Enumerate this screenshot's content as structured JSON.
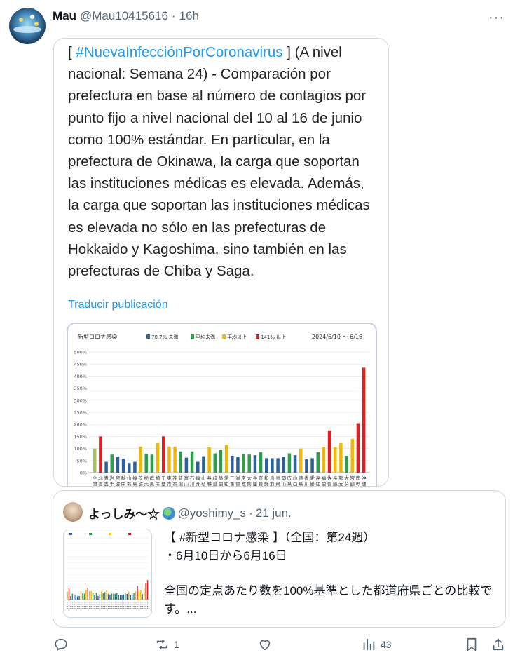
{
  "author": {
    "name": "Mau",
    "handle": "@Mau10415616",
    "separator": "·",
    "time": "16h"
  },
  "menu": {
    "more_label": "···"
  },
  "post": {
    "open_bracket": "[ ",
    "hashtag": "#NuevaInfecciónPorCoronavirus",
    "text_rest": " ] (A nivel nacional: Semana 24) - Comparación por prefectura en base al número de contagios por punto fijo a nivel nacional del 10 al 16 de junio como 100% estándar. En particular, en la prefectura de Okinawa, la carga que soportan las instituciones médicas es elevada. Además, la carga que soportan las instituciones médicas es elevada no sólo en las prefecturas de Hokkaido y Kagoshima, sino también en las prefecturas de Chiba y Saga.",
    "translate_label": "Traducir publicación"
  },
  "chart_data": {
    "type": "bar",
    "title": "新型コロナ感染",
    "date_range": "2024/6/10 ～ 6/16",
    "legend": [
      {
        "name": "70.7% 未満",
        "color": "#2e5f9e"
      },
      {
        "name": "平均未満",
        "color": "#2f9d4e"
      },
      {
        "name": "平均以上",
        "color": "#f2b705"
      },
      {
        "name": "141% 以上",
        "color": "#e02020"
      }
    ],
    "y_ticks": [
      "0%",
      "50%",
      "100%",
      "150%",
      "200%",
      "250%",
      "300%",
      "350%",
      "400%",
      "450%",
      "500%"
    ],
    "ylim": [
      0,
      500
    ],
    "categories": [
      "全国",
      "北海",
      "青森",
      "岩手",
      "宮城",
      "秋田",
      "山形",
      "福島",
      "茨城",
      "栃木",
      "群馬",
      "埼玉",
      "千葉",
      "東京",
      "神奈",
      "新潟",
      "富山",
      "石川",
      "福井",
      "山梨",
      "長野",
      "岐阜",
      "静岡",
      "愛知",
      "三重",
      "滋賀",
      "京都",
      "大阪",
      "兵庫",
      "奈良",
      "和歌",
      "鳥取",
      "島根",
      "岡山",
      "広島",
      "山口",
      "徳島",
      "香川",
      "愛媛",
      "高知",
      "福岡",
      "佐賀",
      "長崎",
      "熊本",
      "大分",
      "宮崎",
      "鹿児",
      "沖縄"
    ],
    "x_tick_labels": [
      "全",
      "北",
      "青",
      "岩",
      "宮",
      "秋",
      "山",
      "福",
      "茨",
      "栃",
      "群",
      "埼",
      "千",
      "東",
      "神",
      "新",
      "富",
      "石",
      "福",
      "山",
      "長",
      "岐",
      "静",
      "愛",
      "三",
      "滋",
      "京",
      "大",
      "兵",
      "奈",
      "和",
      "鳥",
      "島",
      "岡",
      "広",
      "山",
      "徳",
      "香",
      "愛",
      "高",
      "福",
      "佐",
      "長",
      "熊",
      "大",
      "宮",
      "鹿",
      "沖"
    ],
    "x_tick_labels_2": [
      "国",
      "海",
      "森",
      "手",
      "城",
      "田",
      "形",
      "島",
      "城",
      "木",
      "馬",
      "玉",
      "葉",
      "京",
      "奈",
      "潟",
      "山",
      "川",
      "井",
      "梨",
      "野",
      "阜",
      "岡",
      "知",
      "重",
      "賀",
      "都",
      "阪",
      "庫",
      "良",
      "歌",
      "取",
      "根",
      "山",
      "島",
      "口",
      "島",
      "川",
      "媛",
      "知",
      "岡",
      "賀",
      "崎",
      "本",
      "分",
      "崎",
      "児",
      "縄"
    ],
    "values": [
      100,
      150,
      45,
      75,
      65,
      58,
      40,
      45,
      108,
      78,
      75,
      122,
      150,
      108,
      108,
      88,
      62,
      88,
      45,
      68,
      105,
      80,
      95,
      115,
      70,
      65,
      77,
      75,
      72,
      85,
      60,
      60,
      60,
      65,
      80,
      72,
      100,
      55,
      60,
      85,
      105,
      175,
      105,
      122,
      70,
      140,
      205,
      435
    ],
    "colors": [
      "avg",
      "red",
      "blue",
      "green",
      "blue",
      "blue",
      "blue",
      "blue",
      "yellow",
      "green",
      "green",
      "yellow",
      "red",
      "yellow",
      "yellow",
      "green",
      "blue",
      "green",
      "blue",
      "blue",
      "yellow",
      "green",
      "green",
      "yellow",
      "blue",
      "blue",
      "green",
      "green",
      "blue",
      "green",
      "blue",
      "blue",
      "blue",
      "blue",
      "green",
      "blue",
      "yellow",
      "blue",
      "blue",
      "green",
      "yellow",
      "red",
      "yellow",
      "yellow",
      "green",
      "yellow",
      "red",
      "red"
    ]
  },
  "quote": {
    "name": "よっしみ～☆",
    "handle": "@yoshimy_s",
    "separator": "·",
    "date": "21 jun.",
    "line1": "【 #新型コロナ感染 】（全国：第24週）",
    "line2": "・6月10日から6月16日",
    "line3": "全国の定点あたり数を100%基準とした都道府県ごとの比較です。..."
  },
  "actions": {
    "reply_count": "",
    "retweet_count": "1",
    "like_count": "",
    "views_count": "43"
  }
}
